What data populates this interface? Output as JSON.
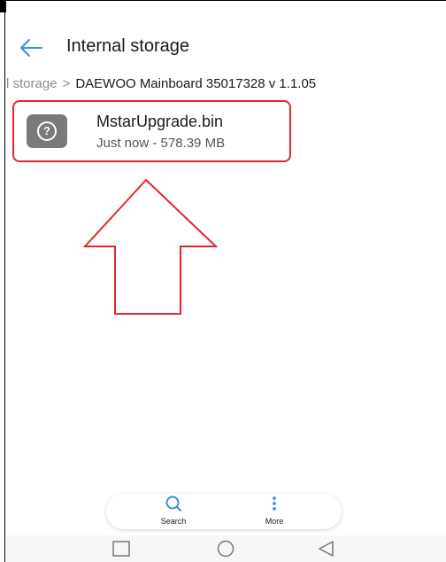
{
  "appbar": {
    "title": "Internal storage",
    "back_icon": "arrow-left-icon"
  },
  "breadcrumb": {
    "previous": "l storage",
    "separator": ">",
    "current": "DAEWOO Mainboard 35017328 v 1.1.05"
  },
  "file": {
    "name": "MstarUpgrade.bin",
    "meta": "Just now - 578.39 MB",
    "icon": "unknown-file-icon",
    "icon_glyph": "?"
  },
  "bottom_bar": {
    "search_label": "Search",
    "more_label": "More"
  },
  "navbar": {
    "keys": [
      "recent-apps-icon",
      "home-icon",
      "back-icon"
    ]
  },
  "colors": {
    "accent": "#3a8ee6",
    "highlight": "#e3262f",
    "file_icon": "#7a7a7a"
  }
}
